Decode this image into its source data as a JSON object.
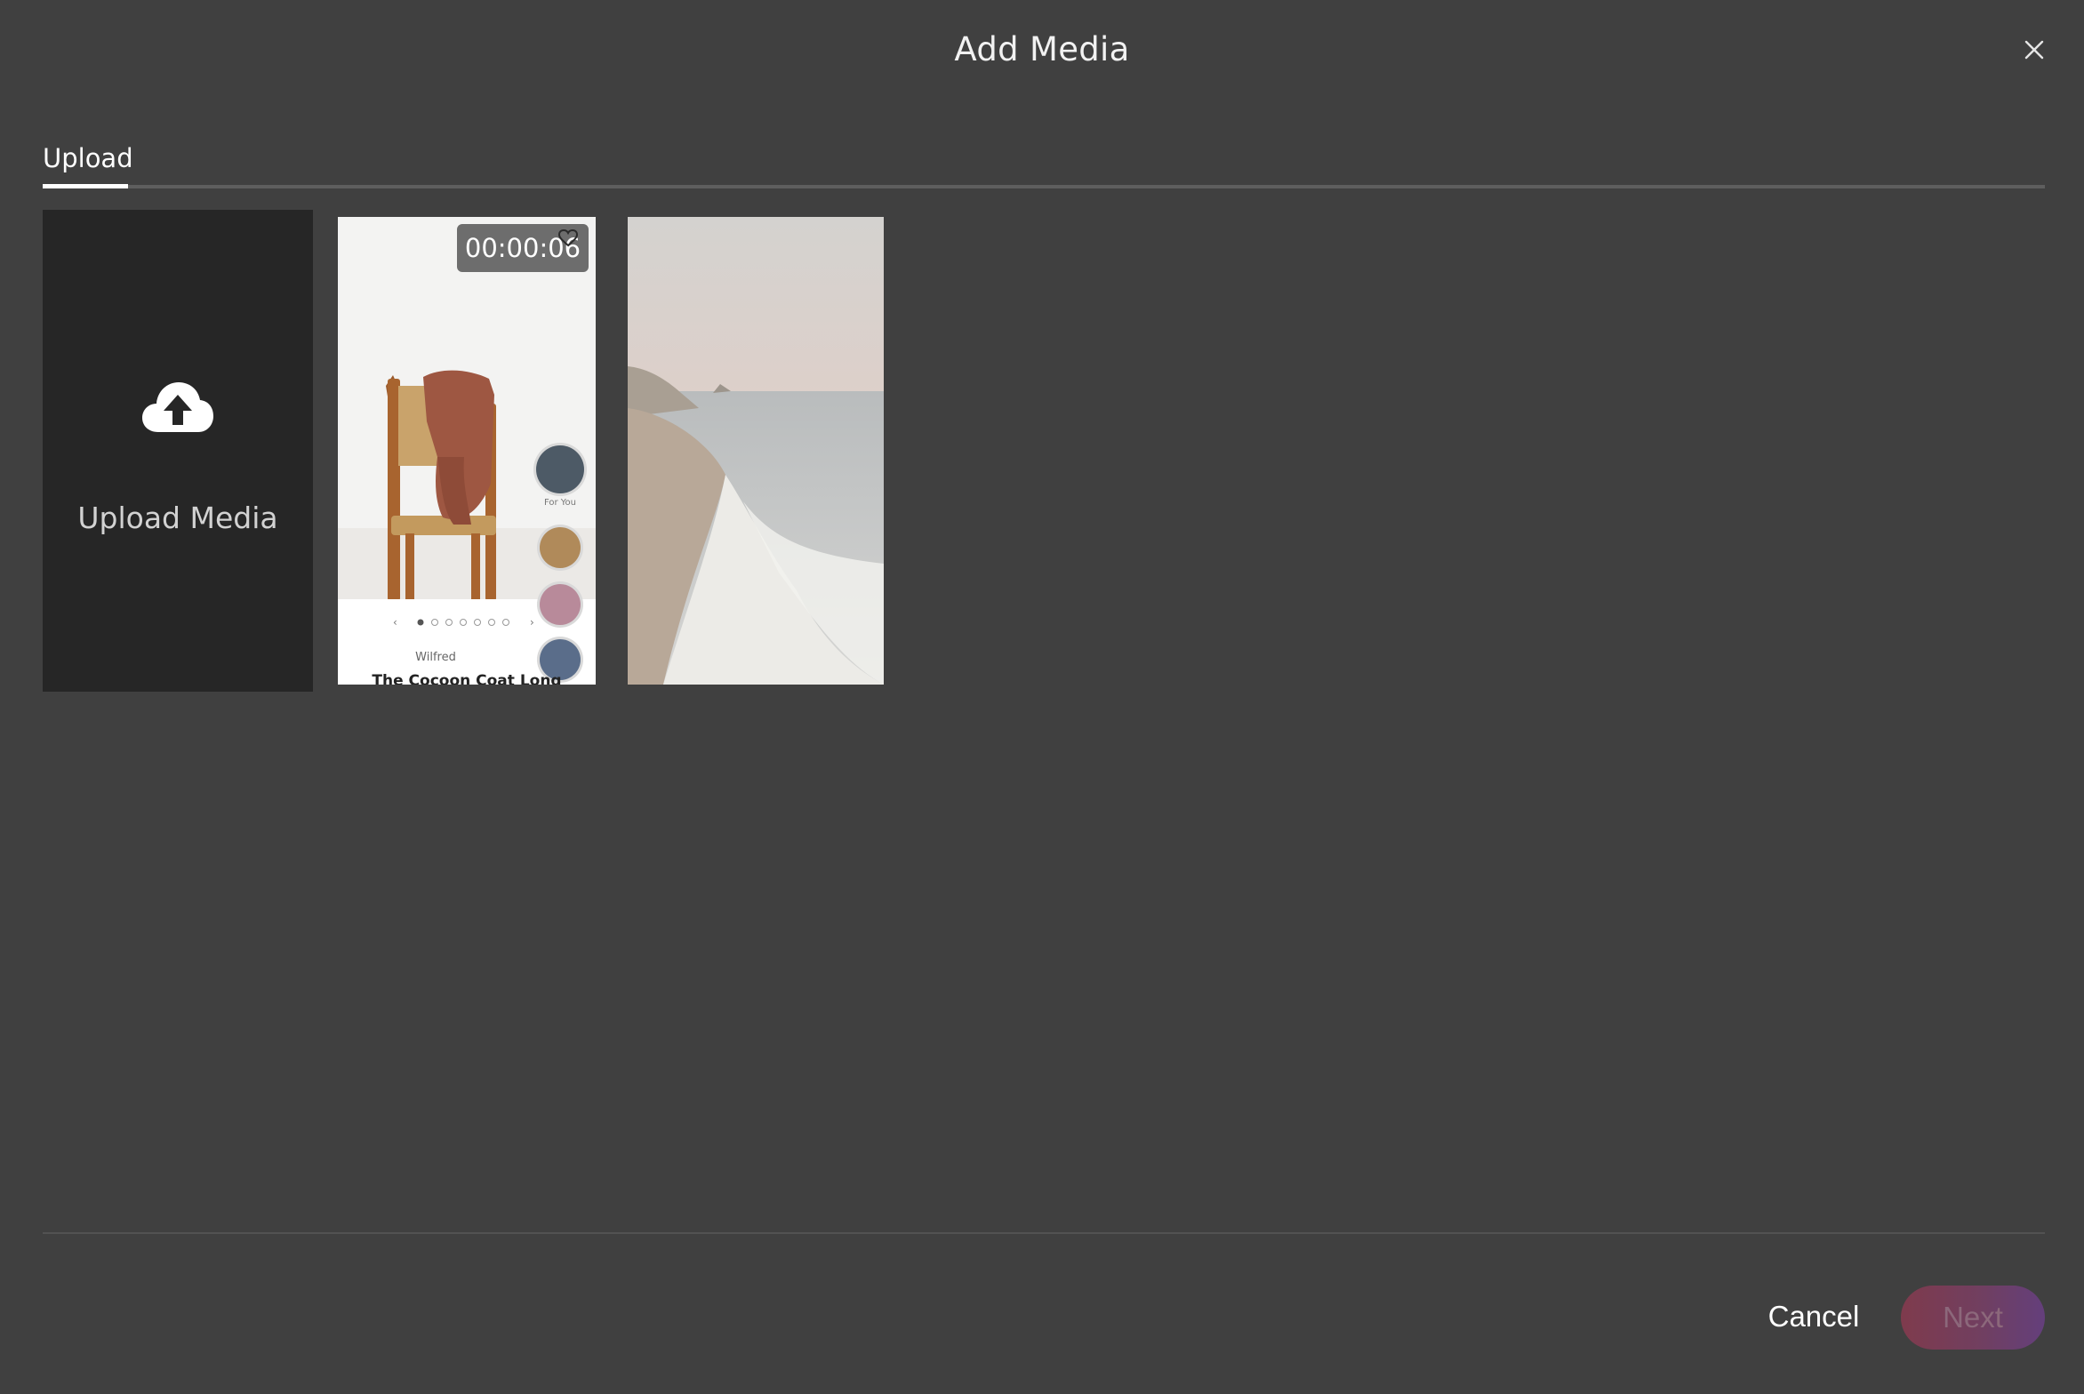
{
  "dialog": {
    "title": "Add Media",
    "close_icon": "close-icon"
  },
  "tabs": [
    {
      "label": "Upload",
      "active": true
    }
  ],
  "upload_tile": {
    "label": "Upload Media",
    "icon": "cloud-upload-icon"
  },
  "media": [
    {
      "type": "video",
      "duration": "00:00:06",
      "thumbnail_text": {
        "brand": "Wilfred",
        "title": "The Cocoon Coat Long",
        "bubble_label": "For You"
      }
    },
    {
      "type": "image"
    }
  ],
  "footer": {
    "cancel_label": "Cancel",
    "next_label": "Next"
  },
  "colors": {
    "background": "#404040",
    "upload_tile": "#262626",
    "next_gradient_start": "#8a3a4f",
    "next_gradient_end": "#6a3f86"
  }
}
